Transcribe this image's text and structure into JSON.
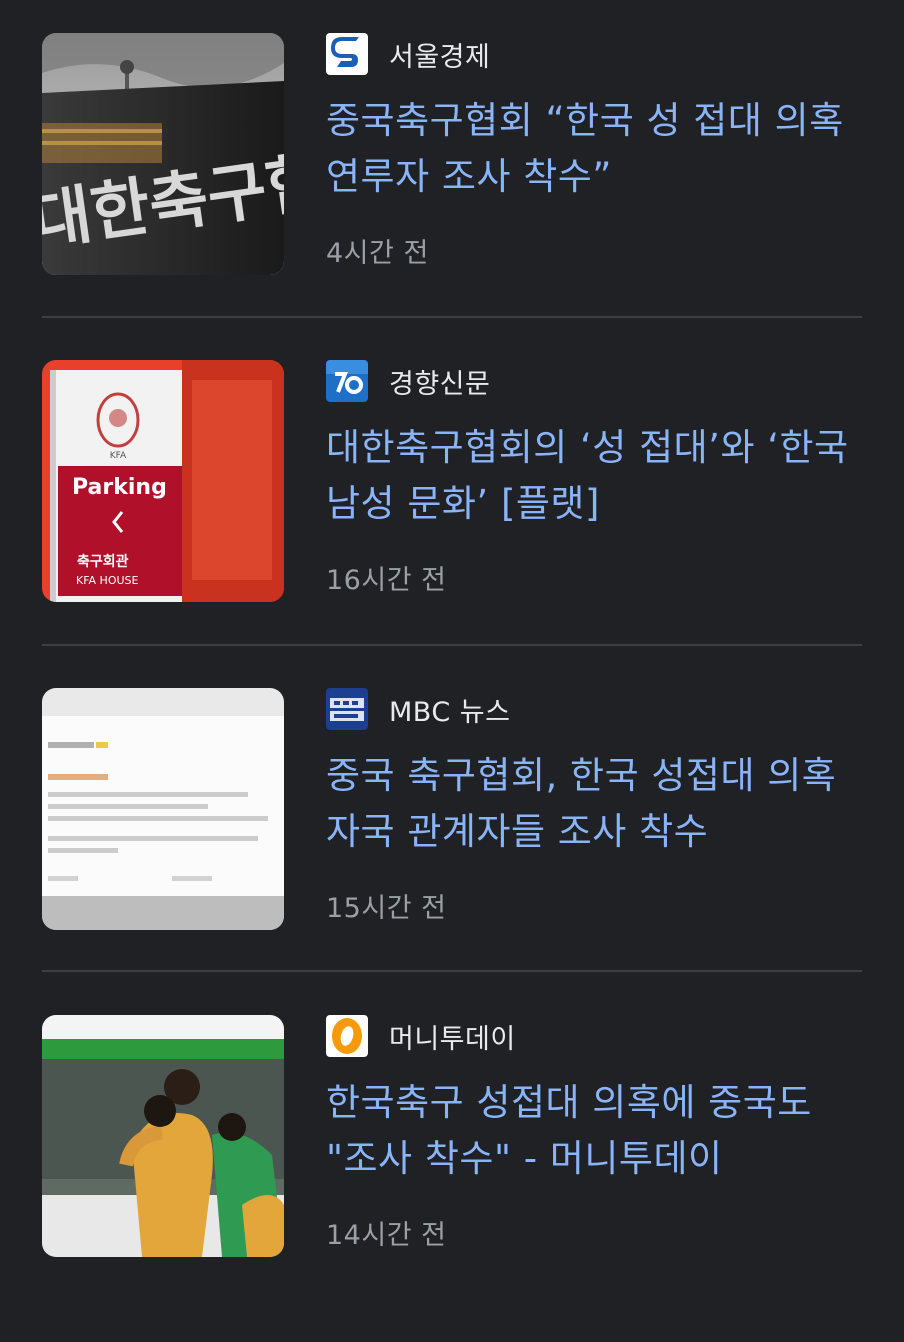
{
  "articles": [
    {
      "source": "서울경제",
      "source_logo_icon": "seoul-economy-logo-icon",
      "headline": "중국축구협회 “한국 성 접대 의혹 연루자 조사 착수”",
      "time": "4시간 전",
      "thumbnail_sign_text": "대한축구협"
    },
    {
      "source": "경향신문",
      "source_logo_icon": "kyunghyang-logo-icon",
      "headline": "대한축구협회의 ‘성 접대’와 ‘한국 남성 문화’ [플랫]",
      "time": "16시간 전",
      "thumbnail_sign_text": [
        "KFA",
        "Parking",
        "축구회관",
        "KFA HOUSE"
      ]
    },
    {
      "source": "MBC 뉴스",
      "source_logo_icon": "mbc-news-logo-icon",
      "headline": "중국 축구협회, 한국 성접대 의혹 자국 관계자들 조사 착수",
      "time": "15시간 전"
    },
    {
      "source": "머니투데이",
      "source_logo_icon": "money-today-logo-icon",
      "headline": "한국축구 성접대 의혹에 중국도 \"조사 착수\" - 머니투데이",
      "time": "14시간 전"
    }
  ],
  "colors": {
    "background": "#202124",
    "headline": "#8ab4f8",
    "source_text": "#e8eaed",
    "time_text": "#9aa0a6",
    "divider": "#3c4043"
  }
}
